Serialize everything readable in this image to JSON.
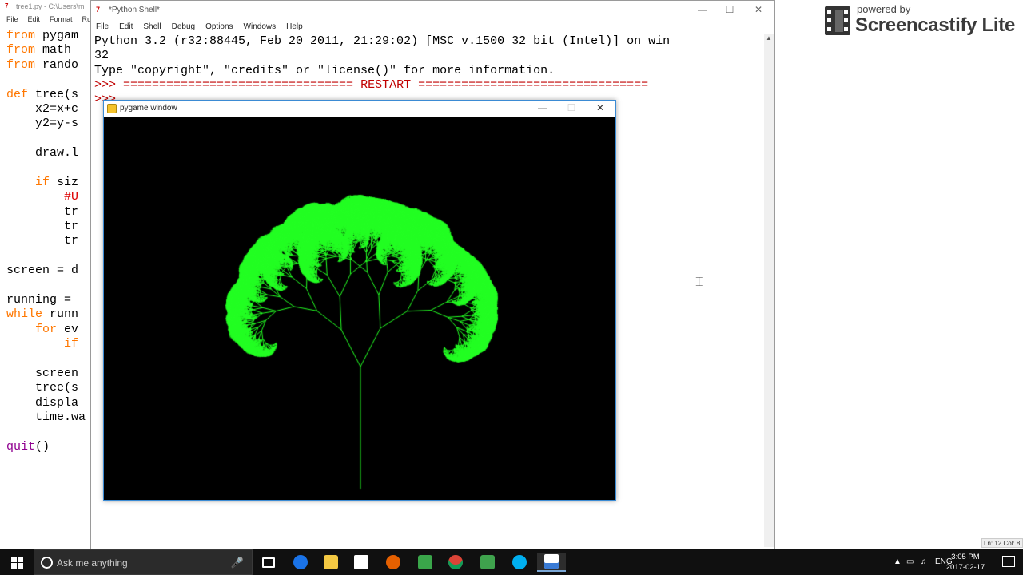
{
  "editor": {
    "title": "tree1.py - C:\\Users\\m",
    "menu": [
      "File",
      "Edit",
      "Format",
      "Ru"
    ],
    "code_lines": [
      [
        {
          "t": "from ",
          "c": "kw"
        },
        {
          "t": "pygam",
          "c": "nm"
        }
      ],
      [
        {
          "t": "from ",
          "c": "kw"
        },
        {
          "t": "math ",
          "c": "nm"
        }
      ],
      [
        {
          "t": "from ",
          "c": "kw"
        },
        {
          "t": "rando",
          "c": "nm"
        }
      ],
      [],
      [
        {
          "t": "def ",
          "c": "kw"
        },
        {
          "t": "tree",
          "c": "nm"
        },
        {
          "t": "(s",
          "c": "nm"
        }
      ],
      [
        {
          "t": "    x2=x+c",
          "c": "nm"
        }
      ],
      [
        {
          "t": "    y2=y-s",
          "c": "nm"
        }
      ],
      [],
      [
        {
          "t": "    draw.l",
          "c": "nm"
        }
      ],
      [],
      [
        {
          "t": "    ",
          "c": "nm"
        },
        {
          "t": "if ",
          "c": "kw"
        },
        {
          "t": "siz",
          "c": "nm"
        }
      ],
      [
        {
          "t": "        #U",
          "c": "cm"
        }
      ],
      [
        {
          "t": "        tr",
          "c": "nm"
        }
      ],
      [
        {
          "t": "        tr",
          "c": "nm"
        }
      ],
      [
        {
          "t": "        tr",
          "c": "nm"
        }
      ],
      [],
      [
        {
          "t": "screen = d",
          "c": "nm"
        }
      ],
      [],
      [
        {
          "t": "running = ",
          "c": "nm"
        }
      ],
      [
        {
          "t": "while ",
          "c": "kw"
        },
        {
          "t": "runn",
          "c": "nm"
        }
      ],
      [
        {
          "t": "    ",
          "c": "nm"
        },
        {
          "t": "for ",
          "c": "kw"
        },
        {
          "t": "ev",
          "c": "nm"
        }
      ],
      [
        {
          "t": "        ",
          "c": "nm"
        },
        {
          "t": "if",
          "c": "kw"
        }
      ],
      [],
      [
        {
          "t": "    screen",
          "c": "nm"
        }
      ],
      [
        {
          "t": "    tree(s",
          "c": "nm"
        }
      ],
      [
        {
          "t": "    displa",
          "c": "nm"
        }
      ],
      [
        {
          "t": "    time.wa",
          "c": "nm"
        }
      ],
      [],
      [
        {
          "t": "quit",
          "c": "kw2"
        },
        {
          "t": "()",
          "c": "nm"
        }
      ]
    ],
    "status": "Ln: 12 Col: 8"
  },
  "shell": {
    "title": "*Python Shell*",
    "menu": [
      "File",
      "Edit",
      "Shell",
      "Debug",
      "Options",
      "Windows",
      "Help"
    ],
    "line1": "Python 3.2 (r32:88445, Feb 20 2011, 21:29:02) [MSC v.1500 32 bit (Intel)] on win",
    "line2": "32",
    "line3": "Type \"copyright\", \"credits\" or \"license()\" for more information.",
    "prompt": ">>> ",
    "restart": "================================ RESTART ================================",
    "prompt2": ">>> "
  },
  "pygame": {
    "title": "pygame window",
    "background": "#000000",
    "tree_color": "#22ff22"
  },
  "watermark": {
    "powered_by": "powered by",
    "brand": "Screencastify Lite"
  },
  "taskbar": {
    "search_placeholder": "Ask me anything",
    "language": "ENG",
    "time": "3:05 PM",
    "date": "2017-02-17"
  },
  "colors": {
    "keyword": "#ff7700",
    "builtin": "#900090",
    "prompt": "#c00000",
    "comment": "#dd0000"
  }
}
